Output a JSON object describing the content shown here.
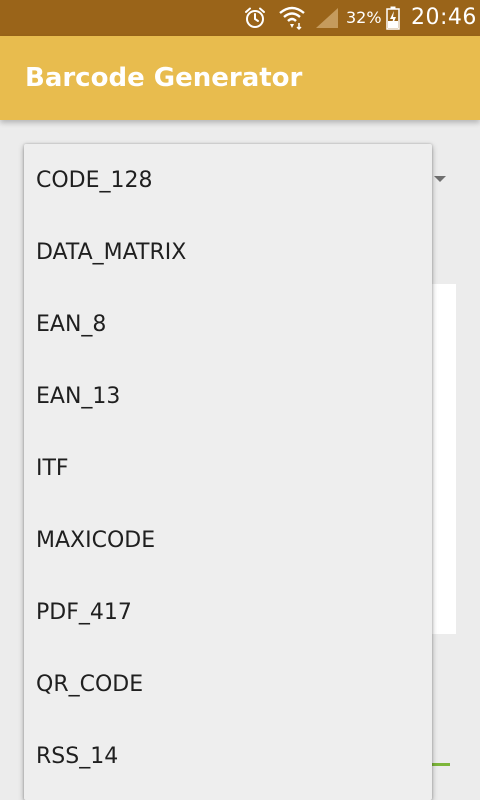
{
  "status_bar": {
    "battery_percent": "32%",
    "time": "20:46",
    "icons": [
      "alarm-icon",
      "wifi-icon",
      "signal-icon",
      "battery-charging-icon"
    ],
    "background": "#9a6419"
  },
  "app_bar": {
    "title": "Barcode Generator",
    "background": "#e8bc4e"
  },
  "dropdown": {
    "items": [
      {
        "label": "CODE_128"
      },
      {
        "label": "DATA_MATRIX"
      },
      {
        "label": "EAN_8"
      },
      {
        "label": "EAN_13"
      },
      {
        "label": "ITF"
      },
      {
        "label": "MAXICODE"
      },
      {
        "label": "PDF_417"
      },
      {
        "label": "QR_CODE"
      },
      {
        "label": "RSS_14"
      }
    ]
  },
  "colors": {
    "accent_green": "#7db63a",
    "screen_background": "#ececec"
  }
}
